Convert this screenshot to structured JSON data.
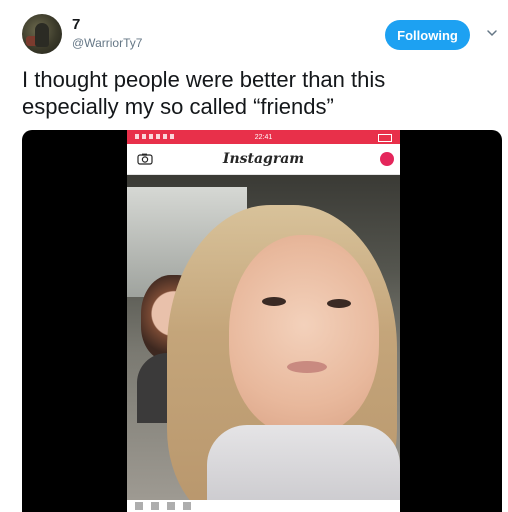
{
  "tweet": {
    "display_name": "7",
    "handle": "@WarriorTy7",
    "follow_label": "Following",
    "text_line1": "I thought people were better than this",
    "text_line2": "especially my so called “friends”"
  },
  "video": {
    "status_time": "22:41",
    "app_logo": "Instagram",
    "icons": {
      "camera": "camera-icon",
      "record": "record-dot-icon",
      "chevron": "chevron-down-icon"
    }
  },
  "colors": {
    "accent": "#1da1f2",
    "status_bar": "#e8304a",
    "record": "#e4265b"
  }
}
